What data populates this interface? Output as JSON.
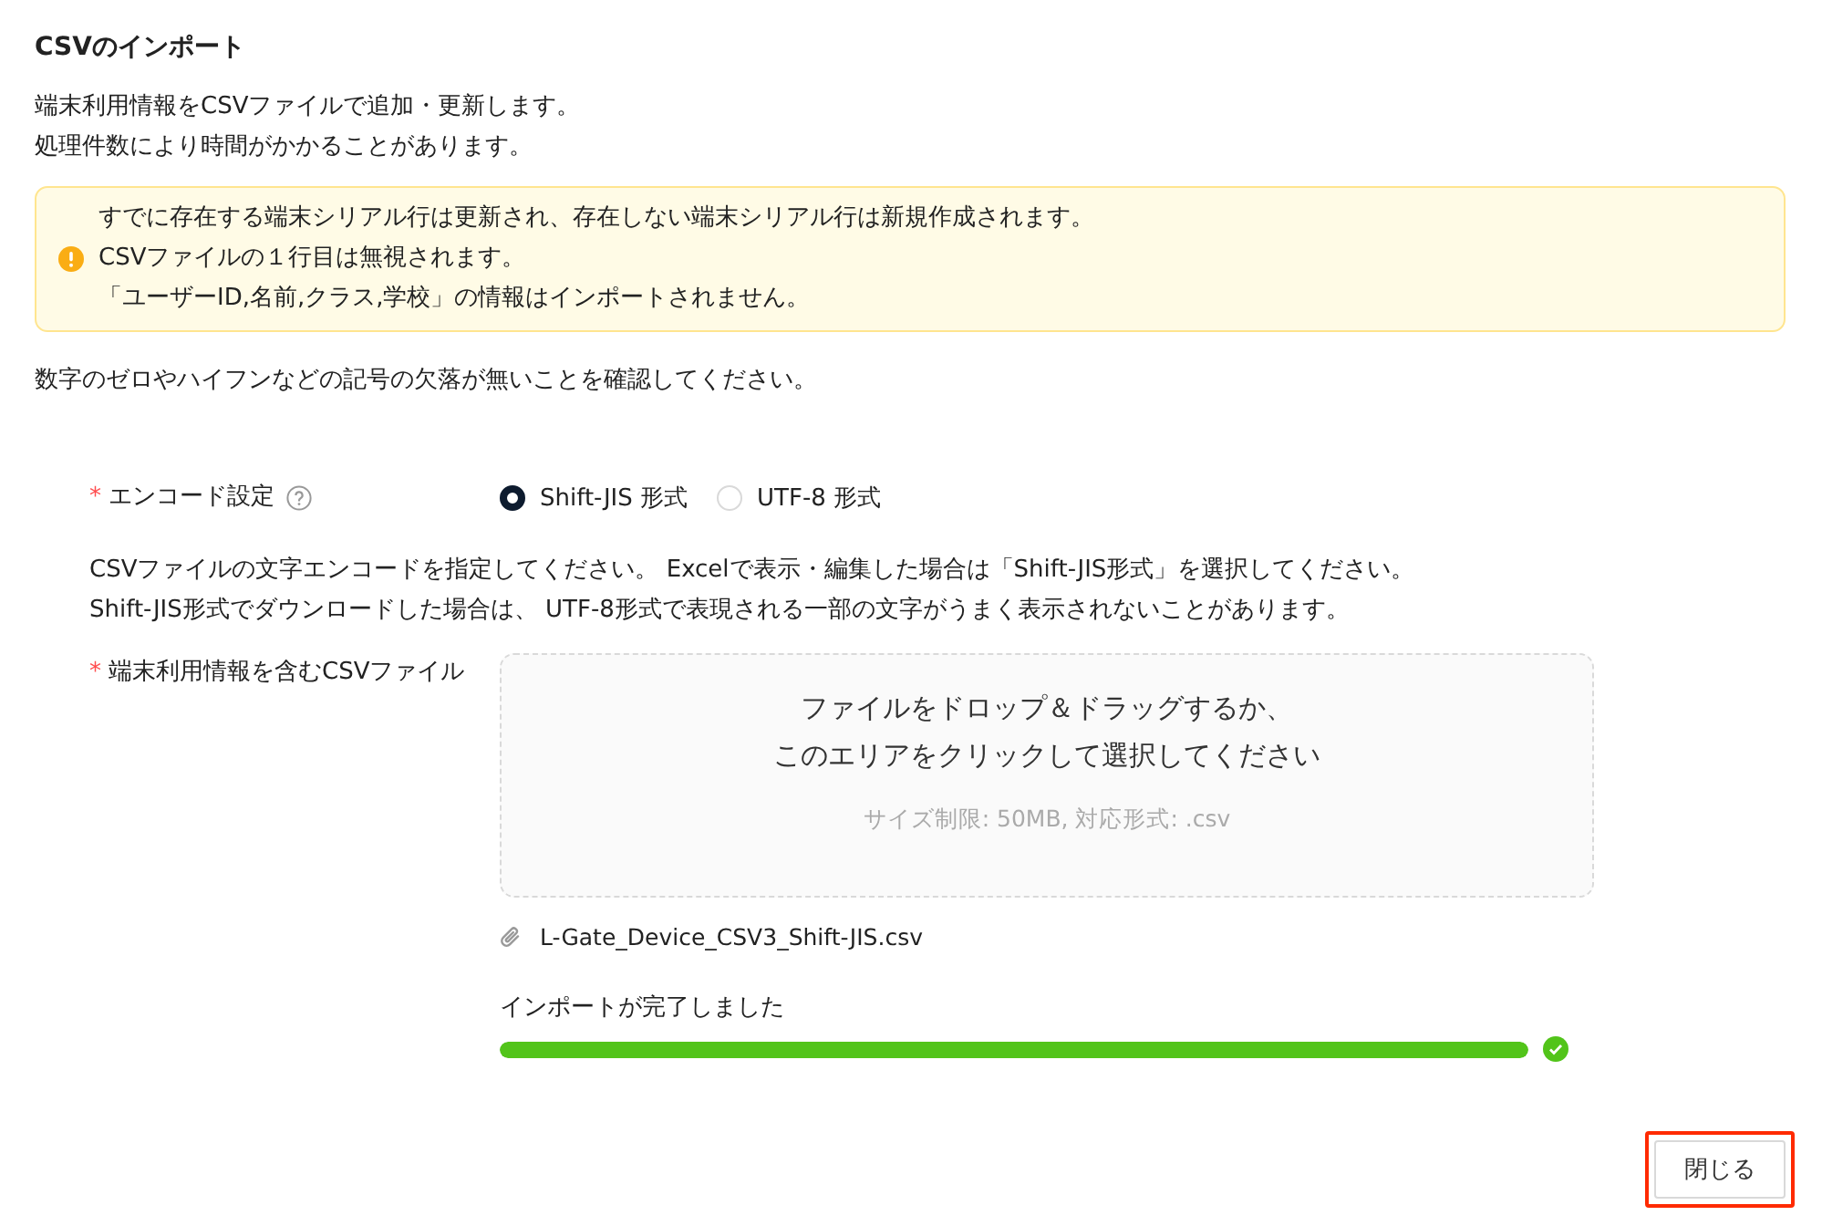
{
  "title": "CSVのインポート",
  "intro": [
    "端末利用情報をCSVファイルで追加・更新します。",
    "処理件数により時間がかかることがあります。"
  ],
  "alert": {
    "kind": "warning",
    "lines": [
      "すでに存在する端末シリアル行は更新され、存在しない端末シリアル行は新規作成されます。",
      "CSVファイルの１行目は無視されます。",
      "「ユーザーID,名前,クラス,学校」の情報はインポートされません。"
    ]
  },
  "note": "数字のゼロやハイフンなどの記号の欠落が無いことを確認してください。",
  "encoding": {
    "required_mark": "*",
    "label": "エンコード設定",
    "options": [
      {
        "label": "Shift-JIS 形式",
        "selected": true
      },
      {
        "label": "UTF-8 形式",
        "selected": false
      }
    ],
    "help": [
      "CSVファイルの文字エンコードを指定してください。 Excelで表示・編集した場合は「Shift-JIS形式」を選択してください。",
      "Shift-JIS形式でダウンロードした場合は、 UTF-8形式で表現される一部の文字がうまく表示されないことがあります。"
    ]
  },
  "file_field": {
    "required_mark": "*",
    "label": "端末利用情報を含むCSVファイル",
    "drop_text": [
      "ファイルをドロップ＆ドラッグするか、",
      "このエリアをクリックして選択してください"
    ],
    "limits": "サイズ制限: 50MB, 対応形式: .csv",
    "file_name": "L-Gate_Device_CSV3_Shift-JIS.csv"
  },
  "progress": {
    "label": "インポートが完了しました",
    "level": 1,
    "done": true
  },
  "close_button": {
    "label": "閉じる",
    "highlighted": true
  }
}
